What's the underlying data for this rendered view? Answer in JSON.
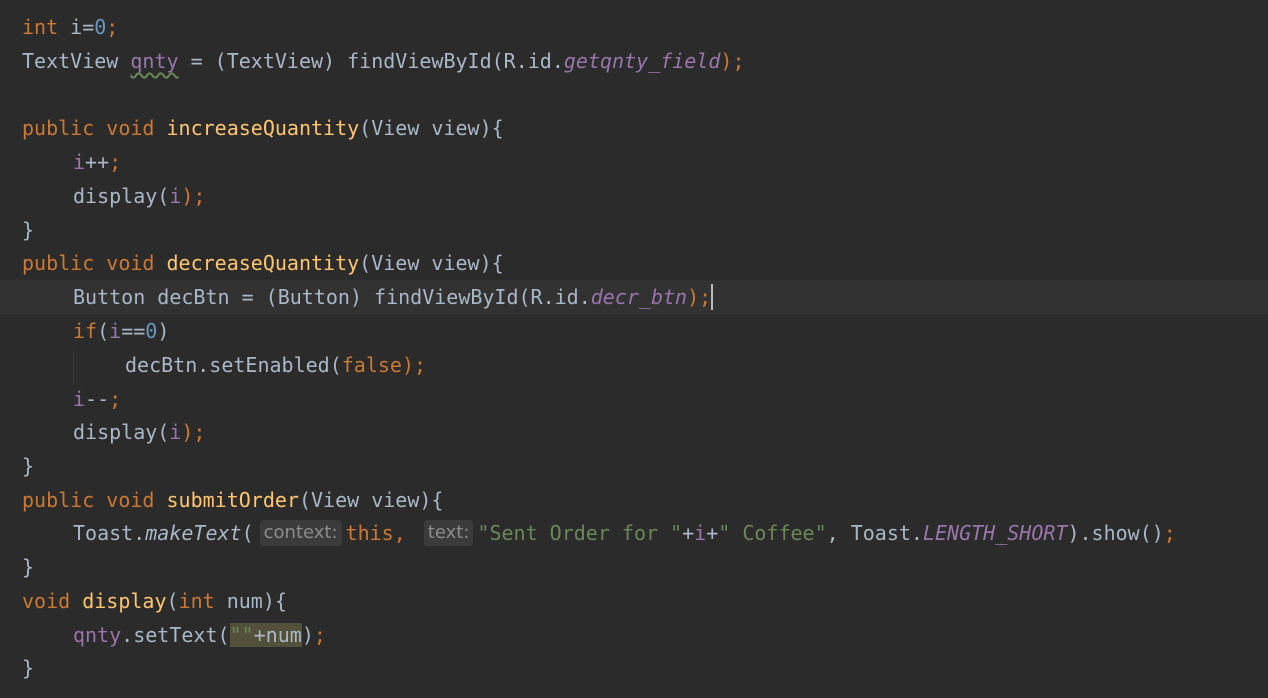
{
  "code": {
    "l1": {
      "kw": "int",
      "rest": " i=",
      "num": "0",
      "semi": ";"
    },
    "l2": {
      "type": "TextView ",
      "var": "qnty",
      "mid": " = (TextView) findViewById(R.id.",
      "field": "getqnty_field",
      "end": ");"
    },
    "l4": {
      "kw": "public void ",
      "fn": "increaseQuantity",
      "rest": "(View view){"
    },
    "l5": {
      "var": "i",
      "rest": "++",
      "semi": ";"
    },
    "l6": {
      "call": "display(",
      "var": "i",
      "end": ");"
    },
    "l7": {
      "brace": "}"
    },
    "l8": {
      "kw": "public void ",
      "fn": "decreaseQuantity",
      "rest": "(View view){"
    },
    "l9": {
      "pre": "Button decBtn = (Button) findViewById(R.id.",
      "field": "decr_btn",
      "end": ");"
    },
    "l10": {
      "kw": "if",
      "p1": "(",
      "var": "i",
      "op": "==",
      "num": "0",
      "p2": ")"
    },
    "l11": {
      "pre": "decBtn.setEnabled(",
      "kw": "false",
      "end": ");"
    },
    "l12": {
      "var": "i",
      "rest": "--",
      "semi": ";"
    },
    "l13": {
      "call": "display(",
      "var": "i",
      "end": ");"
    },
    "l14": {
      "brace": "}"
    },
    "l15": {
      "kw": "public void ",
      "fn": "submitOrder",
      "rest": "(View view){"
    },
    "l16": {
      "pre": "Toast.",
      "method": "makeText",
      "p1": "(",
      "hint1": "context:",
      "this": "this",
      "comma1": ", ",
      "hint2": "text:",
      "str1": "\"Sent Order for \"",
      "plus1": "+",
      "var": "i",
      "plus2": "+",
      "str2": "\" Coffee\"",
      "comma2": ", Toast.",
      "const": "LENGTH_SHORT",
      "end": ").show()",
      "semi": ";"
    },
    "l17": {
      "brace": "}"
    },
    "l18": {
      "kw": "void ",
      "fn": "display",
      "p1": "(",
      "kw2": "int",
      "rest": " num){"
    },
    "l19": {
      "var": "qnty",
      "mid": ".setText(",
      "str": "\"\"",
      "rest": "+num",
      "end": ")",
      "semi": ";"
    },
    "l20": {
      "brace": "}"
    }
  },
  "colors": {
    "background": "#2b2b2b",
    "keyword": "#cc7832",
    "function": "#ffc66d",
    "number": "#6897bb",
    "string": "#6a8759",
    "field": "#9876aa",
    "text": "#a9b7c6"
  }
}
